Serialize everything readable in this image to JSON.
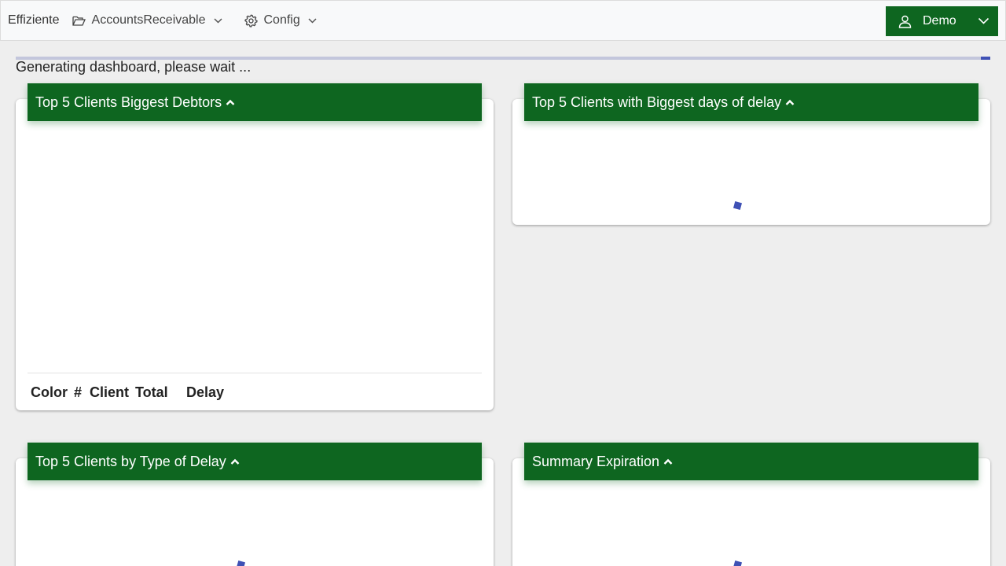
{
  "navbar": {
    "brand": "Effiziente",
    "menu": [
      {
        "label": "AccountsReceivable",
        "icon": "folder-open-icon"
      },
      {
        "label": "Config",
        "icon": "gear-icon"
      }
    ],
    "user": {
      "label": "Demo",
      "icon": "user-icon"
    }
  },
  "status": {
    "message": "Generating dashboard, please wait ...",
    "progress_percent": 1
  },
  "cards": [
    {
      "title": "Top 5 Clients Biggest Debtors",
      "table_headers": [
        "Color",
        "#",
        "Client",
        "Total",
        "Delay"
      ]
    },
    {
      "title": "Top 5 Clients with Biggest days of delay",
      "loading": true
    },
    {
      "title": "Top 5 Clients by Type of Delay",
      "loading": true
    },
    {
      "title": "Summary Expiration",
      "loading": true
    }
  ],
  "colors": {
    "header_green": "#0e6620",
    "spinner_blue": "#3f51b5",
    "progress_track": "#c3c6dc"
  }
}
